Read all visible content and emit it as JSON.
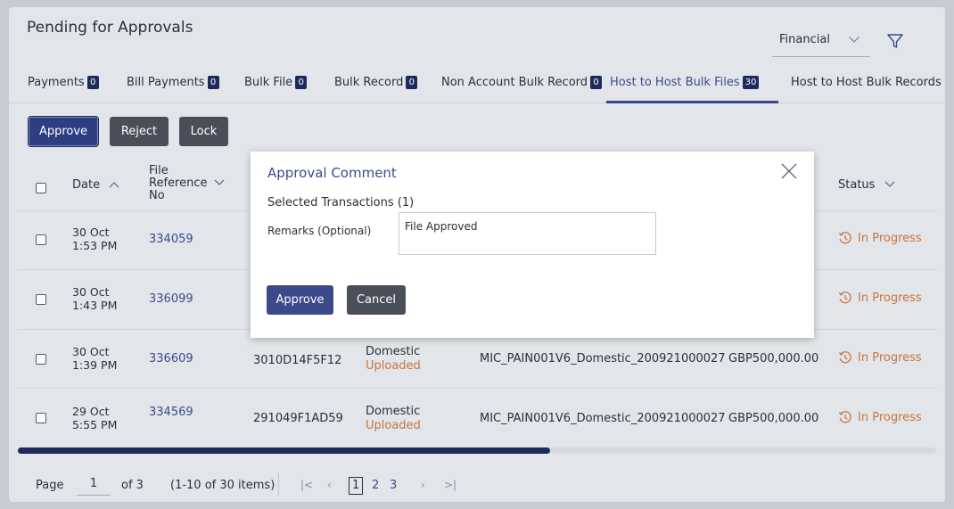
{
  "page": {
    "title": "Pending for Approvals"
  },
  "filter": {
    "selected": "Financial"
  },
  "tabs": [
    {
      "label": "Payments",
      "count": "0"
    },
    {
      "label": "Bill Payments",
      "count": "0"
    },
    {
      "label": "Bulk File",
      "count": "0"
    },
    {
      "label": "Bulk Record",
      "count": "0"
    },
    {
      "label": "Non Account Bulk Record",
      "count": "0"
    },
    {
      "label": "Host to Host Bulk Files",
      "count": "30",
      "active": true
    },
    {
      "label": "Host to Host Bulk Records"
    }
  ],
  "actions": {
    "approve": "Approve",
    "reject": "Reject",
    "lock": "Lock"
  },
  "table": {
    "headers": {
      "date": "Date",
      "file_ref_1": "File",
      "file_ref_2": "Reference",
      "file_ref_3": "No",
      "status": "Status"
    },
    "rows": [
      {
        "date": "30 Oct",
        "time": "1:53 PM",
        "ref": "334059",
        "status": "In Progress"
      },
      {
        "date": "30 Oct",
        "time": "1:43 PM",
        "ref": "336099",
        "status": "In Progress"
      },
      {
        "date": "30 Oct",
        "time": "1:39 PM",
        "ref": "336609",
        "batch": "3010D14F5F12",
        "type": "Domestic",
        "type_status": "Uploaded",
        "file_name": "MIC_PAIN001V6_Domestic_200921000027",
        "amount": "GBP500,000.00",
        "status": "In Progress"
      },
      {
        "date": "29 Oct",
        "time": "5:55 PM",
        "ref": "334569",
        "batch": "291049F1AD59",
        "type": "Domestic",
        "type_status": "Uploaded",
        "file_name": "MIC_PAIN001V6_Domestic_200921000027",
        "amount": "GBP500,000.00",
        "status": "In Progress"
      }
    ]
  },
  "scroll_position": 0.58,
  "pager": {
    "label": "Page",
    "current": "1",
    "of": "of 3",
    "range": "(1-10 of 30 items)",
    "pages": [
      "1",
      "2",
      "3"
    ]
  },
  "modal": {
    "title": "Approval Comment",
    "selected": "Selected Transactions (1)",
    "remarks_label": "Remarks (Optional)",
    "remarks_value": "File Approved",
    "approve": "Approve",
    "cancel": "Cancel"
  },
  "colors": {
    "primary": "#3c4a8a",
    "dark_button": "#4a4e59",
    "badge": "#1d2a5c",
    "in_progress": "#c8763a"
  },
  "icons": {
    "filter": "filter-icon",
    "sort": "chevron-up-icon",
    "close": "close-icon",
    "status": "history-icon"
  }
}
